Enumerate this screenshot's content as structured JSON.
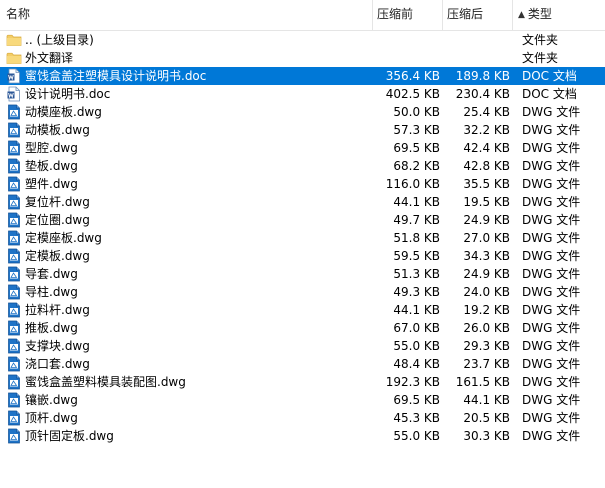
{
  "columns": {
    "name": "名称",
    "packed": "压缩前",
    "size": "压缩后",
    "type_arrow": "▲",
    "type": "类型"
  },
  "colors": {
    "selection": "#0078d7",
    "folder": "#f3cd67",
    "dwg": "#1e73c7",
    "doc": "#2b5797"
  },
  "rows": [
    {
      "icon": "folder-icon",
      "name": ".. (上级目录)",
      "packed": "",
      "size": "",
      "type": "文件夹",
      "selected": false
    },
    {
      "icon": "folder-icon",
      "name": "外文翻译",
      "packed": "",
      "size": "",
      "type": "文件夹",
      "selected": false
    },
    {
      "icon": "doc-file-icon",
      "name": "蜜饯盒盖注塑模具设计说明书.doc",
      "packed": "356.4 KB",
      "size": "189.8 KB",
      "type": "DOC 文档",
      "selected": true
    },
    {
      "icon": "doc-file-icon",
      "name": "设计说明书.doc",
      "packed": "402.5 KB",
      "size": "230.4 KB",
      "type": "DOC 文档",
      "selected": false
    },
    {
      "icon": "dwg-file-icon",
      "name": "动模座板.dwg",
      "packed": "50.0 KB",
      "size": "25.4 KB",
      "type": "DWG 文件",
      "selected": false
    },
    {
      "icon": "dwg-file-icon",
      "name": "动模板.dwg",
      "packed": "57.3 KB",
      "size": "32.2 KB",
      "type": "DWG 文件",
      "selected": false
    },
    {
      "icon": "dwg-file-icon",
      "name": "型腔.dwg",
      "packed": "69.5 KB",
      "size": "42.4 KB",
      "type": "DWG 文件",
      "selected": false
    },
    {
      "icon": "dwg-file-icon",
      "name": "垫板.dwg",
      "packed": "68.2 KB",
      "size": "42.8 KB",
      "type": "DWG 文件",
      "selected": false
    },
    {
      "icon": "dwg-file-icon",
      "name": "塑件.dwg",
      "packed": "116.0 KB",
      "size": "35.5 KB",
      "type": "DWG 文件",
      "selected": false
    },
    {
      "icon": "dwg-file-icon",
      "name": "复位杆.dwg",
      "packed": "44.1 KB",
      "size": "19.5 KB",
      "type": "DWG 文件",
      "selected": false
    },
    {
      "icon": "dwg-file-icon",
      "name": "定位圈.dwg",
      "packed": "49.7 KB",
      "size": "24.9 KB",
      "type": "DWG 文件",
      "selected": false
    },
    {
      "icon": "dwg-file-icon",
      "name": "定模座板.dwg",
      "packed": "51.8 KB",
      "size": "27.0 KB",
      "type": "DWG 文件",
      "selected": false
    },
    {
      "icon": "dwg-file-icon",
      "name": "定模板.dwg",
      "packed": "59.5 KB",
      "size": "34.3 KB",
      "type": "DWG 文件",
      "selected": false
    },
    {
      "icon": "dwg-file-icon",
      "name": "导套.dwg",
      "packed": "51.3 KB",
      "size": "24.9 KB",
      "type": "DWG 文件",
      "selected": false
    },
    {
      "icon": "dwg-file-icon",
      "name": "导柱.dwg",
      "packed": "49.3 KB",
      "size": "24.0 KB",
      "type": "DWG 文件",
      "selected": false
    },
    {
      "icon": "dwg-file-icon",
      "name": "拉料杆.dwg",
      "packed": "44.1 KB",
      "size": "19.2 KB",
      "type": "DWG 文件",
      "selected": false
    },
    {
      "icon": "dwg-file-icon",
      "name": "推板.dwg",
      "packed": "67.0 KB",
      "size": "26.0 KB",
      "type": "DWG 文件",
      "selected": false
    },
    {
      "icon": "dwg-file-icon",
      "name": "支撑块.dwg",
      "packed": "55.0 KB",
      "size": "29.3 KB",
      "type": "DWG 文件",
      "selected": false
    },
    {
      "icon": "dwg-file-icon",
      "name": "浇口套.dwg",
      "packed": "48.4 KB",
      "size": "23.7 KB",
      "type": "DWG 文件",
      "selected": false
    },
    {
      "icon": "dwg-file-icon",
      "name": "蜜饯盒盖塑料模具装配图.dwg",
      "packed": "192.3 KB",
      "size": "161.5 KB",
      "type": "DWG 文件",
      "selected": false
    },
    {
      "icon": "dwg-file-icon",
      "name": "镶嵌.dwg",
      "packed": "69.5 KB",
      "size": "44.1 KB",
      "type": "DWG 文件",
      "selected": false
    },
    {
      "icon": "dwg-file-icon",
      "name": "顶杆.dwg",
      "packed": "45.3 KB",
      "size": "20.5 KB",
      "type": "DWG 文件",
      "selected": false
    },
    {
      "icon": "dwg-file-icon",
      "name": "顶针固定板.dwg",
      "packed": "55.0 KB",
      "size": "30.3 KB",
      "type": "DWG 文件",
      "selected": false
    }
  ]
}
